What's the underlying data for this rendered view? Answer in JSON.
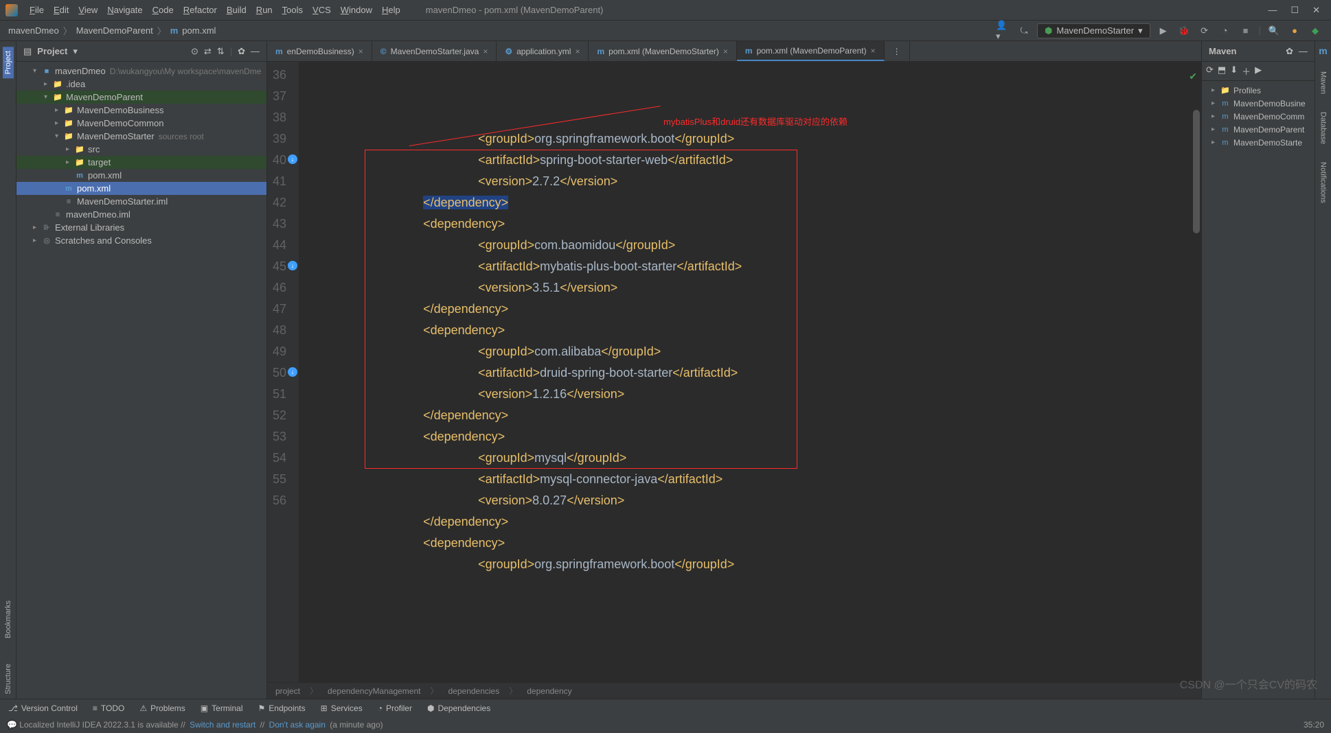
{
  "window_title": "mavenDmeo - pom.xml (MavenDemoParent)",
  "menu": [
    "File",
    "Edit",
    "View",
    "Navigate",
    "Code",
    "Refactor",
    "Build",
    "Run",
    "Tools",
    "VCS",
    "Window",
    "Help"
  ],
  "breadcrumb": [
    "mavenDmeo",
    "MavenDemoParent",
    "pom.xml"
  ],
  "run_config": "MavenDemoStarter",
  "project_panel": {
    "title": "Project",
    "root": {
      "name": "mavenDmeo",
      "path": "D:\\wukangyou\\My workspace\\mavenDmeo"
    },
    "items": [
      {
        "indent": 1,
        "arrow": "▾",
        "icon": "■",
        "cls": "fi-module",
        "label": "mavenDmeo",
        "secondary": "D:\\wukangyou\\My workspace\\mavenDme"
      },
      {
        "indent": 2,
        "arrow": "▸",
        "icon": "📁",
        "cls": "fi-folder",
        "label": ".idea"
      },
      {
        "indent": 2,
        "arrow": "▾",
        "icon": "📁",
        "cls": "fi-module",
        "label": "MavenDemoParent",
        "hl": true
      },
      {
        "indent": 3,
        "arrow": "▸",
        "icon": "📁",
        "cls": "fi-module",
        "label": "MavenDemoBusiness"
      },
      {
        "indent": 3,
        "arrow": "▸",
        "icon": "📁",
        "cls": "fi-module",
        "label": "MavenDemoCommon"
      },
      {
        "indent": 3,
        "arrow": "▾",
        "icon": "📁",
        "cls": "fi-module",
        "label": "MavenDemoStarter",
        "secondary": "sources root"
      },
      {
        "indent": 4,
        "arrow": "▸",
        "icon": "📁",
        "cls": "fi-folder",
        "label": "src"
      },
      {
        "indent": 4,
        "arrow": "▸",
        "icon": "📁",
        "cls": "fi-orange",
        "label": "target",
        "hl": true
      },
      {
        "indent": 4,
        "arrow": "",
        "icon": "m",
        "cls": "fi-m",
        "label": "pom.xml"
      },
      {
        "indent": 3,
        "arrow": "",
        "icon": "m",
        "cls": "fi-m",
        "label": "pom.xml",
        "selected": true
      },
      {
        "indent": 3,
        "arrow": "",
        "icon": "≡",
        "cls": "fi-folder",
        "label": "MavenDemoStarter.iml"
      },
      {
        "indent": 2,
        "arrow": "",
        "icon": "≡",
        "cls": "fi-folder",
        "label": "mavenDmeo.iml"
      },
      {
        "indent": 1,
        "arrow": "▸",
        "icon": "⊪",
        "cls": "fi-folder",
        "label": "External Libraries"
      },
      {
        "indent": 1,
        "arrow": "▸",
        "icon": "◎",
        "cls": "fi-folder",
        "label": "Scratches and Consoles"
      }
    ]
  },
  "tabs": [
    {
      "label": "enDemoBusiness)",
      "icon": "m",
      "active": false
    },
    {
      "label": "MavenDemoStarter.java",
      "icon": "©",
      "active": false
    },
    {
      "label": "application.yml",
      "icon": "⚙",
      "active": false
    },
    {
      "label": "pom.xml (MavenDemoStarter)",
      "icon": "m",
      "active": false
    },
    {
      "label": "pom.xml (MavenDemoParent)",
      "icon": "m",
      "active": true
    }
  ],
  "line_start": 36,
  "gutter_icons": {
    "40": "⊘↓",
    "45": "⊘↓",
    "50": "⊘↓"
  },
  "code_lines": [
    {
      "n": 36,
      "indent": 12,
      "parts": [
        [
          "tag",
          "<groupId>"
        ],
        [
          "val",
          "org.springframework.boot"
        ],
        [
          "tag",
          "</groupId>"
        ]
      ]
    },
    {
      "n": 37,
      "indent": 12,
      "parts": [
        [
          "tag",
          "<artifactId>"
        ],
        [
          "val",
          "spring-boot-starter-web"
        ],
        [
          "tag",
          "</artifactId>"
        ]
      ]
    },
    {
      "n": 38,
      "indent": 12,
      "parts": [
        [
          "tag",
          "<version>"
        ],
        [
          "val",
          "2.7.2"
        ],
        [
          "tag",
          "</version>"
        ]
      ]
    },
    {
      "n": 39,
      "indent": 8,
      "parts": [
        [
          "tag hlclose",
          "</dependency>"
        ]
      ]
    },
    {
      "n": 40,
      "indent": 8,
      "parts": [
        [
          "tag",
          "<dependency>"
        ]
      ]
    },
    {
      "n": 41,
      "indent": 12,
      "parts": [
        [
          "tag",
          "<groupId>"
        ],
        [
          "val",
          "com.baomidou"
        ],
        [
          "tag",
          "</groupId>"
        ]
      ]
    },
    {
      "n": 42,
      "indent": 12,
      "parts": [
        [
          "tag",
          "<artifactId>"
        ],
        [
          "val",
          "mybatis-plus-boot-starter"
        ],
        [
          "tag",
          "</artifactId>"
        ]
      ]
    },
    {
      "n": 43,
      "indent": 12,
      "parts": [
        [
          "tag",
          "<version>"
        ],
        [
          "val",
          "3.5.1"
        ],
        [
          "tag",
          "</version>"
        ]
      ]
    },
    {
      "n": 44,
      "indent": 8,
      "parts": [
        [
          "tag",
          "</dependency>"
        ]
      ]
    },
    {
      "n": 45,
      "indent": 8,
      "parts": [
        [
          "tag",
          "<dependency>"
        ]
      ]
    },
    {
      "n": 46,
      "indent": 12,
      "parts": [
        [
          "tag",
          "<groupId>"
        ],
        [
          "val",
          "com.alibaba"
        ],
        [
          "tag",
          "</groupId>"
        ]
      ]
    },
    {
      "n": 47,
      "indent": 12,
      "parts": [
        [
          "tag",
          "<artifactId>"
        ],
        [
          "val",
          "druid-spring-boot-starter"
        ],
        [
          "tag",
          "</artifactId>"
        ]
      ]
    },
    {
      "n": 48,
      "indent": 12,
      "parts": [
        [
          "tag",
          "<version>"
        ],
        [
          "val",
          "1.2.16"
        ],
        [
          "tag",
          "</version>"
        ]
      ]
    },
    {
      "n": 49,
      "indent": 8,
      "parts": [
        [
          "tag",
          "</dependency>"
        ]
      ]
    },
    {
      "n": 50,
      "indent": 8,
      "parts": [
        [
          "tag",
          "<dependency>"
        ]
      ]
    },
    {
      "n": 51,
      "indent": 12,
      "parts": [
        [
          "tag",
          "<groupId>"
        ],
        [
          "val",
          "mysql"
        ],
        [
          "tag",
          "</groupId>"
        ]
      ]
    },
    {
      "n": 52,
      "indent": 12,
      "parts": [
        [
          "tag",
          "<artifactId>"
        ],
        [
          "val",
          "mysql-connector-java"
        ],
        [
          "tag",
          "</artifactId>"
        ]
      ]
    },
    {
      "n": 53,
      "indent": 12,
      "parts": [
        [
          "tag",
          "<version>"
        ],
        [
          "val",
          "8.0.27"
        ],
        [
          "tag",
          "</version>"
        ]
      ]
    },
    {
      "n": 54,
      "indent": 8,
      "parts": [
        [
          "tag",
          "</dependency>"
        ]
      ]
    },
    {
      "n": 55,
      "indent": 8,
      "parts": [
        [
          "tag",
          "<dependency>"
        ]
      ]
    },
    {
      "n": 56,
      "indent": 12,
      "parts": [
        [
          "tag",
          "<groupId>"
        ],
        [
          "val",
          "org.springframework.boot"
        ],
        [
          "tag",
          "</groupId>"
        ]
      ]
    }
  ],
  "annotation": "mybatisPlus和druid还有数据库驱动对应的依赖",
  "code_breadcrumb": [
    "project",
    "dependencyManagement",
    "dependencies",
    "dependency"
  ],
  "maven_panel": {
    "title": "Maven",
    "items": [
      "Profiles",
      "MavenDemoBusine",
      "MavenDemoComm",
      "MavenDemoParent",
      "MavenDemoStarte"
    ]
  },
  "bottom_tabs": [
    "Version Control",
    "TODO",
    "Problems",
    "Terminal",
    "Endpoints",
    "Services",
    "Profiler",
    "Dependencies"
  ],
  "status": {
    "left": "Localized IntelliJ IDEA 2022.3.1 is available",
    "links": [
      "Switch and restart",
      "Don't ask again"
    ],
    "time": "(a minute ago)",
    "right": "35:20"
  },
  "watermark": "CSDN @一个只会CV的码农",
  "left_sidebar": [
    "Project",
    "Bookmarks",
    "Structure"
  ],
  "right_sidebar": [
    "Maven",
    "Database",
    "Notifications"
  ]
}
